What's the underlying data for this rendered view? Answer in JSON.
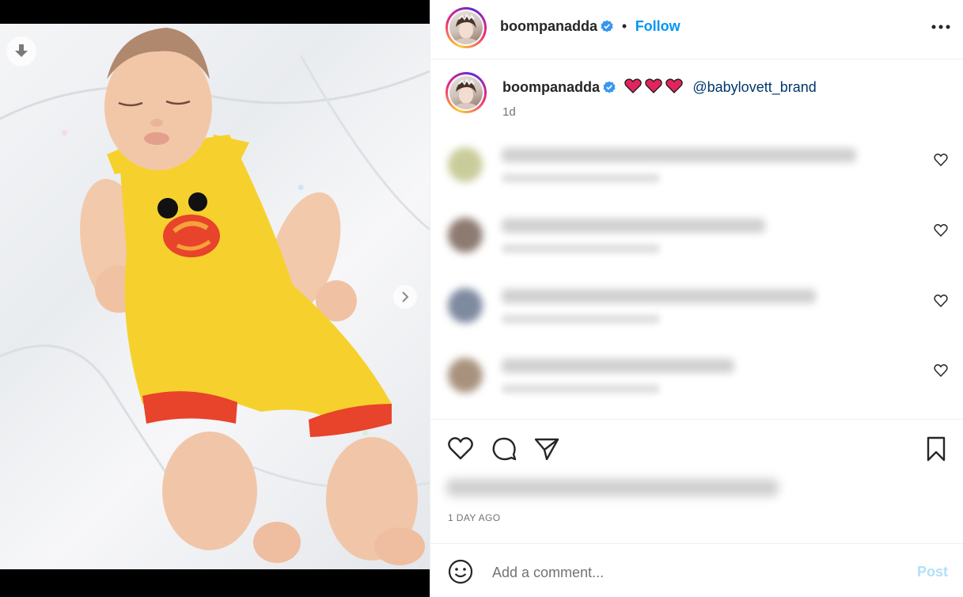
{
  "media": {
    "download_icon": "download-arrow-icon",
    "next_icon": "chevron-right-icon"
  },
  "header": {
    "username": "boompanadda",
    "separator": "•",
    "follow_label": "Follow",
    "more_icon": "more-horizontal-icon"
  },
  "caption": {
    "username": "boompanadda",
    "hearts": "❤️❤️❤️",
    "mention": "@babylovett_brand",
    "time": "1d"
  },
  "comments": [
    {
      "avatar_color": "#c9cc9a",
      "text_width": 0.7
    },
    {
      "avatar_color": "#8d7a70",
      "text_width": 0.52
    },
    {
      "avatar_color": "#7d8aa0",
      "text_width": 0.62
    },
    {
      "avatar_color": "#a8927e",
      "text_width": 0.46
    }
  ],
  "actions": {
    "like_icon": "heart-icon",
    "comment_icon": "comment-bubble-icon",
    "share_icon": "paper-plane-icon",
    "save_icon": "bookmark-icon",
    "timestamp": "1 DAY AGO"
  },
  "composer": {
    "emoji_icon": "smiley-face-icon",
    "placeholder": "Add a comment...",
    "post_label": "Post"
  },
  "colors": {
    "accent": "#0095f6",
    "post_disabled": "#b2dffc",
    "verified": "#3897f0",
    "heart_red": "#e0245e"
  }
}
